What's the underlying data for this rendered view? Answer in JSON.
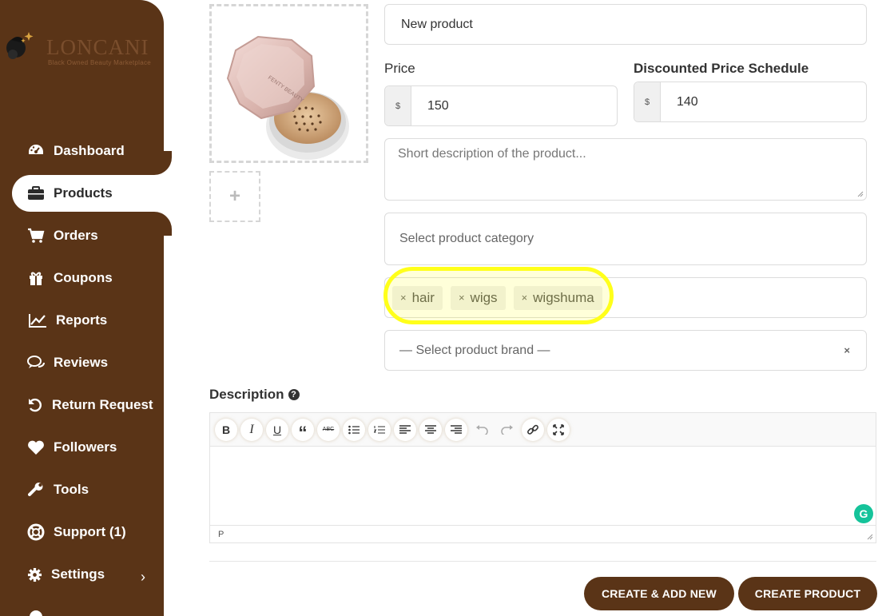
{
  "brand": {
    "name": "LONCANI",
    "tagline": "Black Owned Beauty Marketplace",
    "sidebar_color": "#5a3417"
  },
  "sidebar": {
    "items": [
      {
        "label": "Dashboard",
        "icon": "gauge-icon"
      },
      {
        "label": "Products",
        "icon": "briefcase-icon",
        "active": true
      },
      {
        "label": "Orders",
        "icon": "cart-icon"
      },
      {
        "label": "Coupons",
        "icon": "gift-icon"
      },
      {
        "label": "Reports",
        "icon": "chart-line-icon"
      },
      {
        "label": "Reviews",
        "icon": "comments-icon"
      },
      {
        "label": "Return Request",
        "icon": "undo-icon"
      },
      {
        "label": "Followers",
        "icon": "heart-icon"
      },
      {
        "label": "Tools",
        "icon": "wrench-icon"
      },
      {
        "label": "Support (1)",
        "icon": "lifebuoy-icon"
      },
      {
        "label": "Settings",
        "icon": "gear-icon"
      }
    ]
  },
  "product_image": {
    "add_symbol": "+"
  },
  "form": {
    "title_value": "New product",
    "price_label": "Price",
    "price_currency": "$",
    "price_value": "150",
    "discount_label": "Discounted Price Schedule",
    "discount_currency": "$",
    "discount_value": "140",
    "short_desc_placeholder": "Short description of the product...",
    "category_placeholder": "Select product category",
    "tags": [
      "hair",
      "wigs",
      "wigshuma"
    ],
    "tag_remove_symbol": "×",
    "brand_placeholder": "— Select product brand —",
    "brand_clear_symbol": "×"
  },
  "description": {
    "label": "Description",
    "help_symbol": "?",
    "status_path": "P",
    "grammarly_symbol": "G"
  },
  "toolbar": {
    "bold": "B",
    "italic": "I",
    "underline": "U",
    "blockquote": "“",
    "strikethrough": "ABC"
  },
  "actions": {
    "create_add_new": "CREATE & ADD NEW",
    "create_product": "CREATE PRODUCT"
  }
}
